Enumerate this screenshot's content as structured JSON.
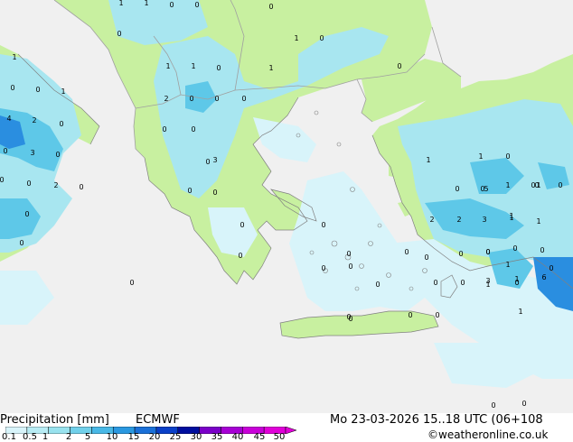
{
  "map": {
    "colors": {
      "sea": "#f0f0f0",
      "land": "#c8f0a0",
      "precip_light": "#d8f4fa",
      "precip_med": "#a8e6f0",
      "precip_heavy": "#5ec8e8",
      "precip_very_heavy": "#2a8ee0",
      "border": "#a0a0a0",
      "coast": "#808080"
    },
    "values": [
      {
        "label": "1"
      },
      {
        "label": "1"
      },
      {
        "label": "0"
      },
      {
        "label": "0"
      },
      {
        "label": "0"
      },
      {
        "label": "0"
      },
      {
        "label": "1"
      },
      {
        "label": "0"
      },
      {
        "label": "1"
      },
      {
        "label": "1"
      },
      {
        "label": "1"
      },
      {
        "label": "0"
      },
      {
        "label": "0"
      },
      {
        "label": "1"
      },
      {
        "label": "0"
      },
      {
        "label": "0"
      },
      {
        "label": "1"
      },
      {
        "label": "0"
      },
      {
        "label": "2"
      },
      {
        "label": "0"
      },
      {
        "label": "0"
      },
      {
        "label": "0"
      },
      {
        "label": "4"
      },
      {
        "label": "2"
      },
      {
        "label": "0"
      },
      {
        "label": "0"
      },
      {
        "label": "3"
      },
      {
        "label": "0"
      },
      {
        "label": "0"
      },
      {
        "label": "1"
      },
      {
        "label": "3"
      },
      {
        "label": "0"
      },
      {
        "label": "1"
      },
      {
        "label": "0"
      },
      {
        "label": "0"
      },
      {
        "label": "2"
      },
      {
        "label": "0"
      },
      {
        "label": "0"
      },
      {
        "label": "0"
      },
      {
        "label": "0"
      },
      {
        "label": "0"
      },
      {
        "label": "1"
      },
      {
        "label": "0"
      },
      {
        "label": "0"
      },
      {
        "label": "0"
      },
      {
        "label": "0"
      },
      {
        "label": "0"
      },
      {
        "label": "0"
      },
      {
        "label": "0"
      },
      {
        "label": "0"
      },
      {
        "label": "0"
      },
      {
        "label": "0"
      },
      {
        "label": "0"
      },
      {
        "label": "0"
      },
      {
        "label": "0"
      },
      {
        "label": "0"
      },
      {
        "label": "0"
      },
      {
        "label": "0"
      },
      {
        "label": "1"
      },
      {
        "label": "0"
      },
      {
        "label": "0"
      },
      {
        "label": "0"
      },
      {
        "label": "0"
      },
      {
        "label": "0"
      },
      {
        "label": "0"
      },
      {
        "label": "0"
      },
      {
        "label": "0"
      },
      {
        "label": "5"
      },
      {
        "label": "0"
      },
      {
        "label": "1"
      },
      {
        "label": "1"
      },
      {
        "label": "2"
      },
      {
        "label": "2"
      },
      {
        "label": "3"
      },
      {
        "label": "1"
      },
      {
        "label": "1"
      },
      {
        "label": "0"
      },
      {
        "label": "0"
      },
      {
        "label": "0"
      },
      {
        "label": "1"
      },
      {
        "label": "3"
      },
      {
        "label": "1"
      },
      {
        "label": "6"
      },
      {
        "label": "1"
      },
      {
        "label": "0"
      },
      {
        "label": "0"
      },
      {
        "label": "0"
      }
    ]
  },
  "footer": {
    "title": "Precipitation [mm]",
    "model": "ECMWF",
    "datetime": "Mo 23-03-2026 15..18 UTC (06+108",
    "credit": "©weatheronline.co.uk",
    "scale_labels": [
      "0.1",
      "0.5",
      "1",
      "2",
      "5",
      "10",
      "15",
      "20",
      "25",
      "30",
      "35",
      "40",
      "45",
      "50"
    ],
    "scale_colors": [
      "#d8f4fa",
      "#b8ecf4",
      "#98e2ee",
      "#70d0ea",
      "#48b8e6",
      "#2a98e0",
      "#1a70d8",
      "#0a40c8",
      "#000e9e",
      "#7a00c8",
      "#a600d4",
      "#c800d8",
      "#e000d8"
    ]
  }
}
